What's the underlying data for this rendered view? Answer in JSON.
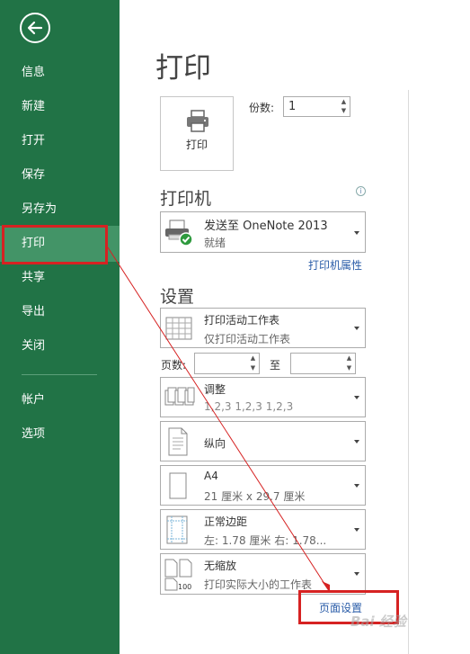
{
  "sidebar": {
    "items": [
      {
        "label": "信息"
      },
      {
        "label": "新建"
      },
      {
        "label": "打开"
      },
      {
        "label": "保存"
      },
      {
        "label": "另存为"
      },
      {
        "label": "打印"
      },
      {
        "label": "共享"
      },
      {
        "label": "导出"
      },
      {
        "label": "关闭"
      },
      {
        "label": "帐户"
      },
      {
        "label": "选项"
      }
    ],
    "active": "打印",
    "color": "#217346",
    "active_color": "#439467"
  },
  "main": {
    "title": "打印",
    "print_button_label": "打印",
    "copies_label": "份数:",
    "copies_value": "1",
    "printer_section": "打印机",
    "printer": {
      "name": "发送至 OneNote 2013",
      "status": "就绪"
    },
    "printer_properties": "打印机属性",
    "settings_section": "设置",
    "settings": [
      {
        "main": "打印活动工作表",
        "sub": "仅打印活动工作表"
      },
      {
        "main": "调整",
        "sub": "1,2,3    1,2,3    1,2,3"
      },
      {
        "main": "纵向",
        "sub": ""
      },
      {
        "main": "A4",
        "sub": "21 厘米 x 29.7 厘米"
      },
      {
        "main": "正常边距",
        "sub": "左: 1.78 厘米    右: 1.78..."
      },
      {
        "main": "无缩放",
        "sub": "打印实际大小的工作表"
      }
    ],
    "pages_label": "页数:",
    "to_label": "至",
    "page_setup": "页面设置"
  },
  "annotation_color": "#d62222",
  "watermark": "Bai 经验"
}
